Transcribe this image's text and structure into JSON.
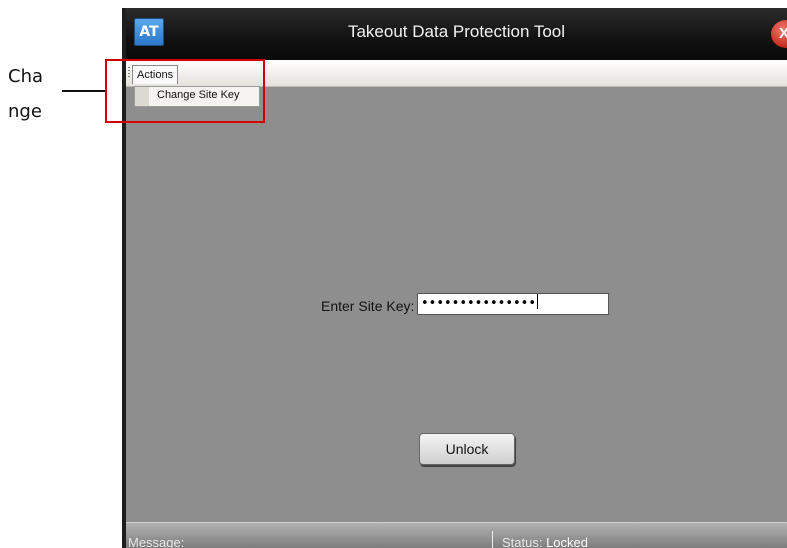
{
  "annotation": {
    "line1": "Cha",
    "line2": "nge"
  },
  "window": {
    "title": "Takeout Data Protection Tool",
    "app_icon_text": "AT",
    "close_glyph": "X"
  },
  "menu": {
    "actions_label": "Actions",
    "items": [
      {
        "label": "Change Site Key"
      }
    ]
  },
  "form": {
    "site_key_label": "Enter Site Key:",
    "site_key_value": "•••••••••••••••",
    "unlock_label": "Unlock"
  },
  "statusbar": {
    "message_label": "Message:",
    "status_label": "Status: ",
    "status_value": "Locked"
  },
  "colors": {
    "highlight": "#d40000",
    "window_bg": "#8e8e8e",
    "titlebar": "#111111"
  }
}
